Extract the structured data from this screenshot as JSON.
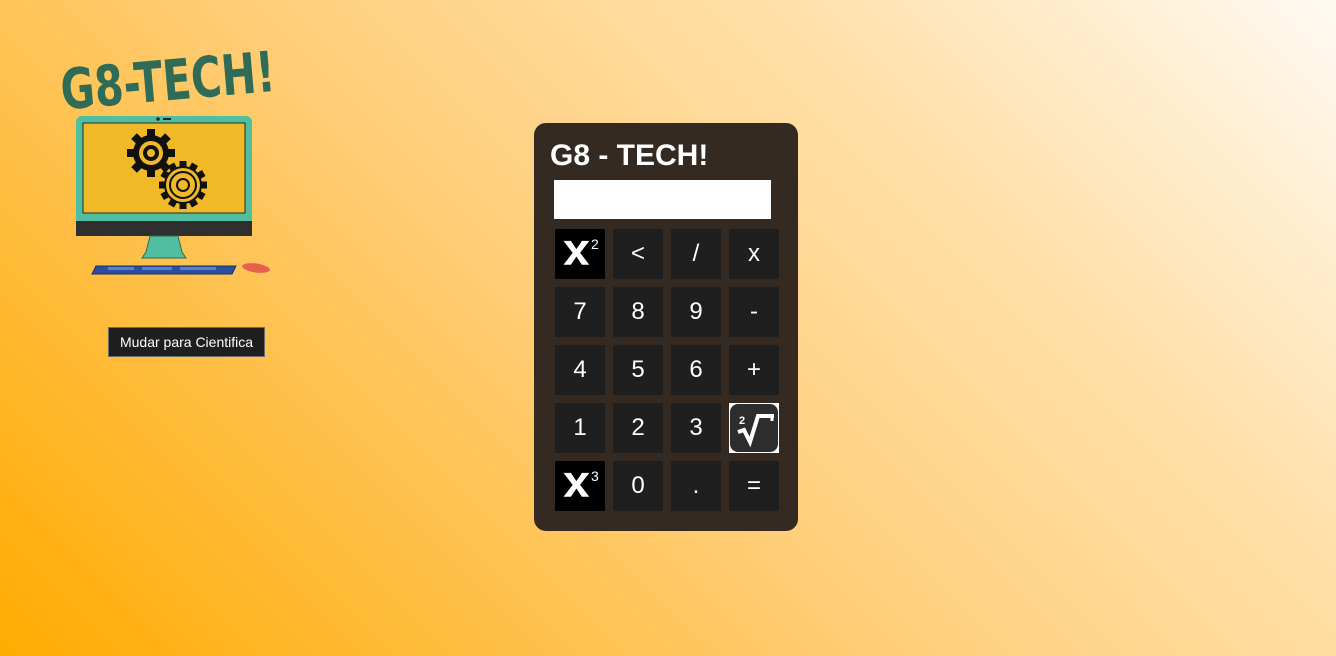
{
  "logo": {
    "brand_text": "G8-TECH!",
    "icon": "computer-with-gears-icon"
  },
  "mode_switch": {
    "label": "Mudar para Cientifica"
  },
  "calculator": {
    "title": "G8 - TECH!",
    "display": {
      "value": "",
      "placeholder": ""
    },
    "keys": [
      {
        "id": "square",
        "label": "x²",
        "icon": "x-squared-icon"
      },
      {
        "id": "backspace",
        "label": "<"
      },
      {
        "id": "divide",
        "label": "/"
      },
      {
        "id": "multiply",
        "label": "x"
      },
      {
        "id": "seven",
        "label": "7"
      },
      {
        "id": "eight",
        "label": "8"
      },
      {
        "id": "nine",
        "label": "9"
      },
      {
        "id": "minus",
        "label": "-"
      },
      {
        "id": "four",
        "label": "4"
      },
      {
        "id": "five",
        "label": "5"
      },
      {
        "id": "six",
        "label": "6"
      },
      {
        "id": "plus",
        "label": "+"
      },
      {
        "id": "one",
        "label": "1"
      },
      {
        "id": "two",
        "label": "2"
      },
      {
        "id": "three",
        "label": "3"
      },
      {
        "id": "square-root",
        "label": "²√",
        "icon": "square-root-icon"
      },
      {
        "id": "cube",
        "label": "x³",
        "icon": "x-cubed-icon"
      },
      {
        "id": "zero",
        "label": "0"
      },
      {
        "id": "decimal",
        "label": "."
      },
      {
        "id": "equals",
        "label": "="
      }
    ]
  },
  "colors": {
    "calculator_body": "#342a21",
    "key_background": "#1f1f1f",
    "logo_text": "#2f6b57",
    "monitor_frame": "#4fbf9f",
    "monitor_screen": "#f0b928"
  }
}
